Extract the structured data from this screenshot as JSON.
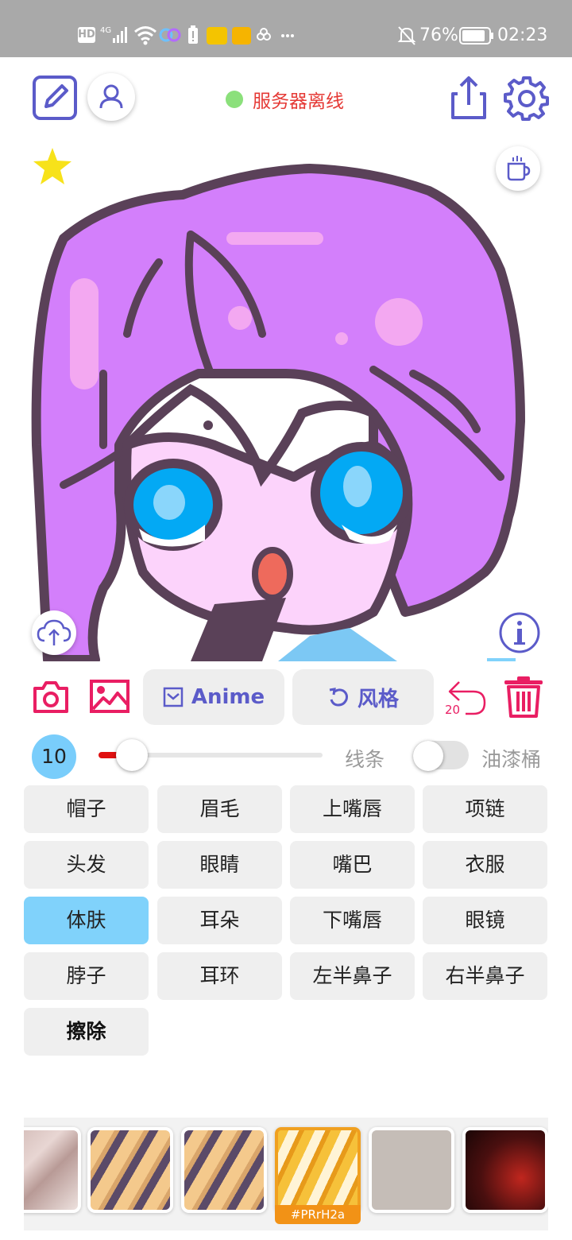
{
  "status_bar": {
    "left_icons": [
      "hd-icon",
      "4g-signal-icon",
      "wifi-icon",
      "link-icon",
      "battery-alert-icon",
      "app-badge-icon",
      "mail-icon",
      "more-icon"
    ],
    "battery_percent": "76%",
    "time": "02:23"
  },
  "toolbar": {
    "server_status": "服务器离线",
    "server_status_color": "#e53935"
  },
  "tools": {
    "model_button": "Anime",
    "style_button": "风格",
    "undo_count": "20"
  },
  "brush": {
    "size": "10",
    "size_fraction": 0.15,
    "line_label": "线条",
    "bucket_label": "油漆桶",
    "bucket_enabled": false
  },
  "parts": [
    {
      "label": "帽子",
      "active": false
    },
    {
      "label": "眉毛",
      "active": false
    },
    {
      "label": "上嘴唇",
      "active": false
    },
    {
      "label": "项链",
      "active": false
    },
    {
      "label": "头发",
      "active": false
    },
    {
      "label": "眼睛",
      "active": false
    },
    {
      "label": "嘴巴",
      "active": false
    },
    {
      "label": "衣服",
      "active": false
    },
    {
      "label": "体肤",
      "active": true
    },
    {
      "label": "耳朵",
      "active": false
    },
    {
      "label": "下嘴唇",
      "active": false
    },
    {
      "label": "眼镜",
      "active": false
    },
    {
      "label": "脖子",
      "active": false
    },
    {
      "label": "耳环",
      "active": false
    },
    {
      "label": "左半鼻子",
      "active": false
    },
    {
      "label": "右半鼻子",
      "active": false
    },
    {
      "label": "擦除",
      "active": false
    }
  ],
  "thumbnails": {
    "selected_caption": "#PRrH2a"
  },
  "colors": {
    "accent": "#5b5bc9",
    "danger": "#e91e63",
    "hair": "#d37ffb",
    "outline": "#5a4158",
    "skin": "#fcd3fb",
    "eye": "#03a9f4",
    "selected_part": "#80d2fb"
  }
}
